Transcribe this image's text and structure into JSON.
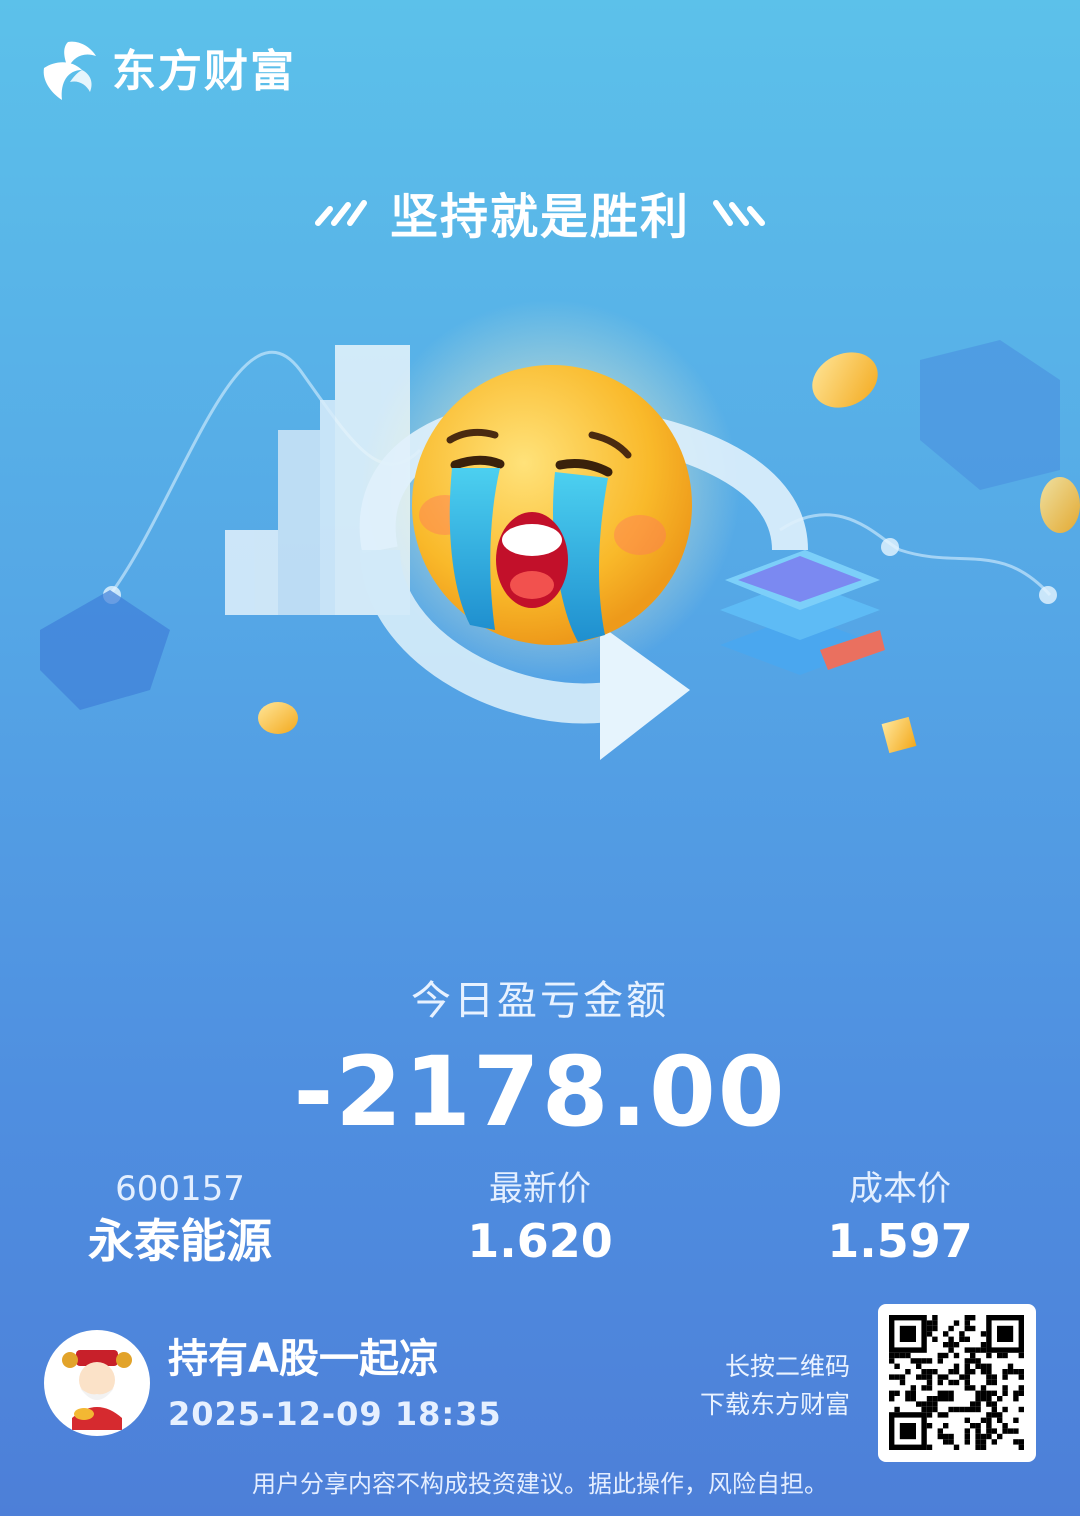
{
  "brand": {
    "name": "东方财富",
    "logo_icon": "eastmoney-logo-icon"
  },
  "slogan": {
    "text": "坚持就是胜利"
  },
  "illustration": {
    "icon": "crying-emoji-icon"
  },
  "pnl": {
    "label": "今日盈亏金额",
    "value": "-2178.00"
  },
  "stock": {
    "code": "600157",
    "name": "永泰能源"
  },
  "latest_price": {
    "label": "最新价",
    "value": "1.620"
  },
  "cost_price": {
    "label": "成本价",
    "value": "1.597"
  },
  "footer": {
    "user_slogan": "持有A股一起凉",
    "timestamp": "2025-12-09 18:35",
    "qr_hint_line1": "长按二维码",
    "qr_hint_line2": "下载东方财富",
    "disclaimer": "用户分享内容不构成投资建议。据此操作，风险自担。"
  },
  "colors": {
    "bg_top": "#5cc1ea",
    "bg_bottom": "#4d7fd8",
    "text": "#ffffff",
    "emoji": "#f5b61e",
    "tear": "#2fb2e0"
  }
}
